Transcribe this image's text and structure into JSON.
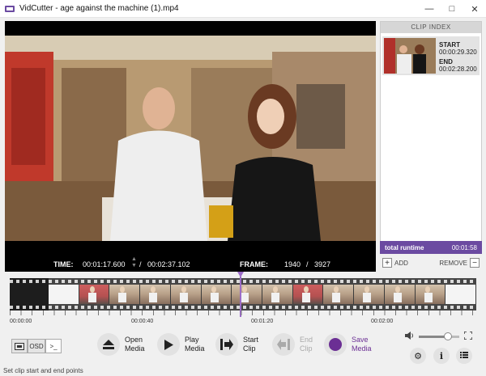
{
  "window": {
    "title": "VidCutter - age against the machine (1).mp4"
  },
  "video": {
    "time_label": "TIME:",
    "current_time": "00:01:17.600",
    "time_separator": "/",
    "total_time": "00:02:37.102",
    "frame_label": "FRAME:",
    "current_frame": "1940",
    "frame_separator": "/",
    "total_frames": "3927"
  },
  "clip_index": {
    "header": "CLIP INDEX",
    "clips": [
      {
        "start_label": "START",
        "start": "00:00:29.320",
        "end_label": "END",
        "end": "00:02:28.200"
      }
    ],
    "runtime_label": "total runtime",
    "runtime_value": "00:01:58",
    "add_label": "ADD",
    "remove_label": "REMOVE"
  },
  "timeline": {
    "ruler_labels": [
      "00:00:00",
      "00:00:40",
      "00:01:20",
      "00:02:00"
    ],
    "playhead_fraction": 0.494
  },
  "toolbar": {
    "mode_buttons": {
      "osd": "OSD",
      "console": ">_"
    },
    "open_media": "Open\nMedia",
    "play_media": "Play\nMedia",
    "start_clip": "Start\nClip",
    "end_clip": "End\nClip",
    "save_media": "Save\nMedia"
  },
  "volume": {
    "level": 0.72
  },
  "status": {
    "text": "Set clip start and end points"
  },
  "colors": {
    "accent": "#6b4aa1",
    "playhead": "#9b6bc7",
    "save": "#6b2f94"
  }
}
